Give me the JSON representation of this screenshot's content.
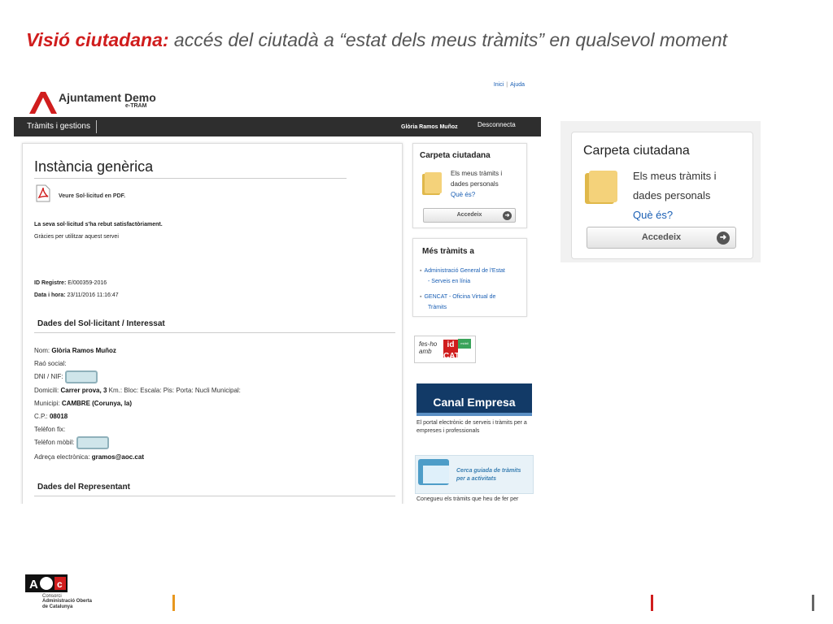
{
  "slide": {
    "title_bold": "Visió ciutadana:",
    "title_rest": " accés del ciutadà a “estat dels meus tràmits” en qualsevol moment"
  },
  "header": {
    "logo_name": "Ajuntament Demo",
    "logo_sub": "e-TRAM",
    "link_home": "Inici",
    "link_sep": "|",
    "link_help": "Ajuda"
  },
  "nav": {
    "menu_label": "Tràmits i gestions",
    "user_name": "Glòria Ramos Muñoz",
    "logout_label": "Desconnecta"
  },
  "content": {
    "title": "Instància genèrica",
    "pdf_link": "Veure Sol·licitud en PDF.",
    "success_msg": "La seva sol·licitud s'ha rebut satisfactòriament.",
    "thanks_msg": "Gràcies per utilitzar aquest servei",
    "registry_label": "ID Registre:",
    "registry_value": "E/000359-2016",
    "datetime_label": "Data i hora:",
    "datetime_value": "23/11/2016 11:16:47",
    "applicant_heading": "Dades del Sol·licitant / Interessat",
    "representative_heading": "Dades del Representant",
    "fields": {
      "name_label": "Nom:",
      "name_value": "Glòria Ramos Muñoz",
      "company_label": "Raó social:",
      "dni_label": "DNI / NIF:",
      "address_label": "Domicili:",
      "address_value": "Carrer prova, 3",
      "address_rest": "Km.:  Bloc:  Escala:  Pis:  Porta:  Nucli Municipal:",
      "city_label": "Municipi:",
      "city_value": "CAMBRE (Corunya, la)",
      "zip_label": "C.P.:",
      "zip_value": "08018",
      "phone_label": "Telèfon fix:",
      "mobile_label": "Telèfon mòbil:",
      "email_label": "Adreça electrònica:",
      "email_value": "gramos@aoc.cat"
    }
  },
  "citizen_folder": {
    "title": "Carpeta ciutadana",
    "desc_line1": "Els meus tràmits i",
    "desc_line2": "dades personals",
    "what_is": "Què és?",
    "access_label": "Accedeix",
    "arrow": "➜"
  },
  "more_procedures": {
    "title": "Més tràmits a",
    "item1_line1": "Administració General de l'Estat",
    "item1_line2": "- Serveis en línia",
    "item2_line1": "GENCAT - Oficina Virtual de",
    "item2_line2": "Tràmits",
    "bullet": "▪"
  },
  "banners": {
    "idcat_hand_line1": "fes-ho",
    "idcat_hand_line2": "amb",
    "idcat_label": "id CAT",
    "idcat_mobile": "mòbil",
    "canal_title": "Canal Empresa",
    "canal_desc": "El portal electrònic de serveis i tràmits per a empreses i professionals",
    "guide_line1": "Cerca guiada de tràmits",
    "guide_line2": "per a activitats",
    "guide_desc": "Conegueu els tràmits que heu de fer per"
  },
  "footer": {
    "aoc_line1": "Consorci",
    "aoc_line2": "Administració Oberta",
    "aoc_line3": "de Catalunya"
  },
  "colors": {
    "accent_red": "#d01d1d",
    "nav_dark": "#2e2e2e",
    "link_blue": "#1a5fb4",
    "canal_blue": "#123a67"
  }
}
